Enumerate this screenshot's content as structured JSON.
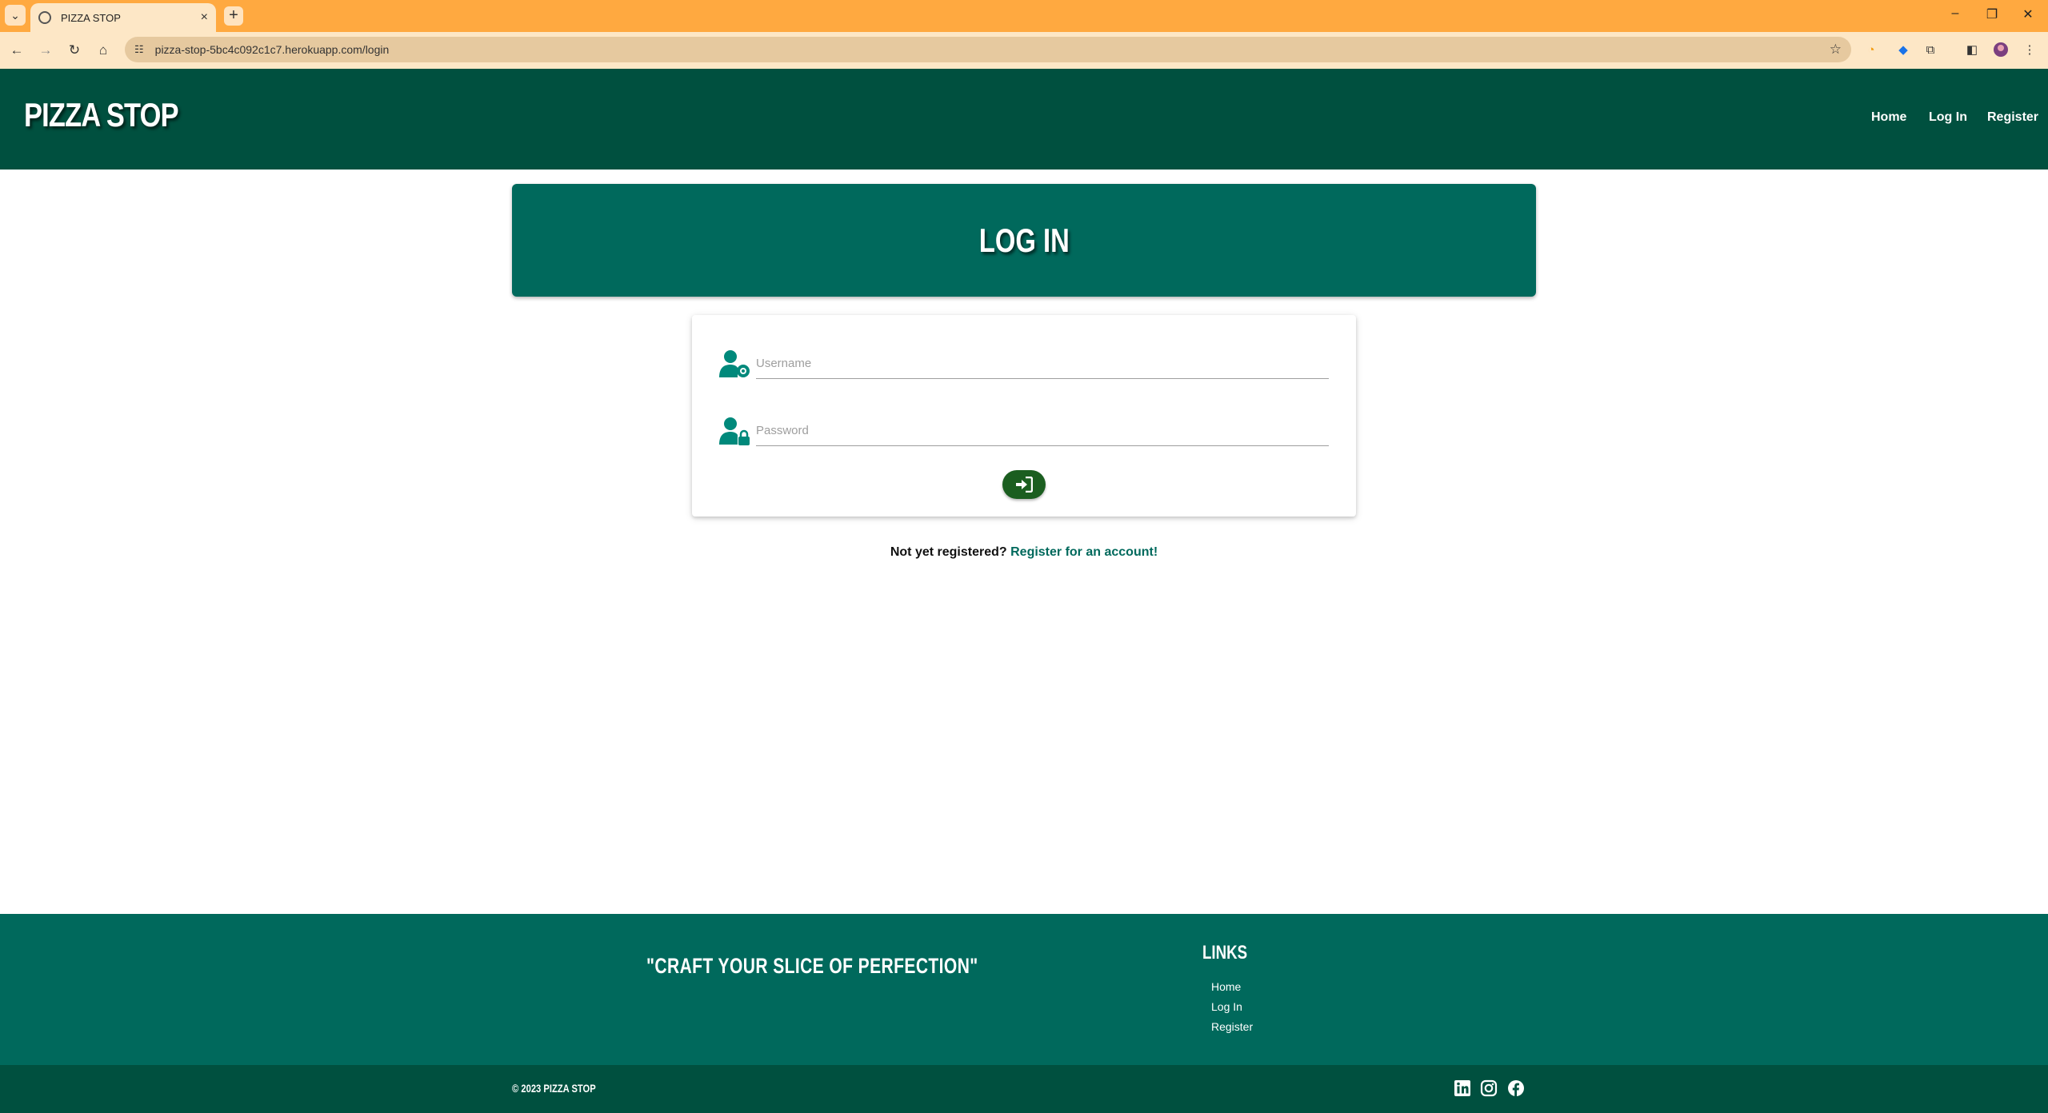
{
  "browser": {
    "tab_title": "PIZZA STOP",
    "url": "pizza-stop-5bc4c092c1c7.herokuapp.com/login"
  },
  "header": {
    "brand": "PIZZA STOP",
    "nav": [
      "Home",
      "Log In",
      "Register"
    ]
  },
  "page": {
    "title": "LOG IN"
  },
  "form": {
    "username_placeholder": "Username",
    "password_placeholder": "Password",
    "username_icon": "user-gear-icon",
    "password_icon": "user-lock-icon",
    "submit_icon": "sign-in-icon"
  },
  "register_prompt": {
    "text": "Not yet registered?",
    "link": "Register for an account!"
  },
  "footer": {
    "tagline": "\"CRAFT YOUR SLICE OF PERFECTION\"",
    "links_heading": "LINKS",
    "links": [
      "Home",
      "Log In",
      "Register"
    ],
    "copyright": "© 2023 PIZZA STOP",
    "social": [
      "linkedin-icon",
      "instagram-icon",
      "facebook-icon"
    ]
  },
  "colors": {
    "header_bg": "#00503f",
    "primary": "#00695c",
    "button": "#1b5e20",
    "chrome": "#ffa940"
  }
}
